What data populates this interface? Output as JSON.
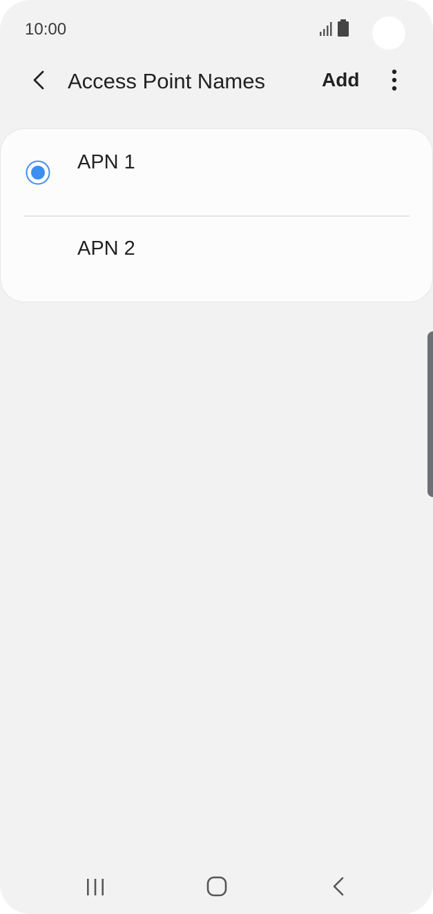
{
  "status_bar": {
    "time": "10:00",
    "signal_icon": "signal-bars-icon",
    "battery_icon": "battery-icon"
  },
  "app_bar": {
    "title": "Access Point Names",
    "add_label": "Add",
    "back_icon": "chevron-left-icon",
    "more_icon": "more-vertical-icon"
  },
  "apn_list": {
    "items": [
      {
        "label": "APN 1",
        "selected": true
      },
      {
        "label": "APN 2",
        "selected": false
      }
    ]
  },
  "nav_bar": {
    "recents_icon": "recents-icon",
    "home_icon": "home-icon",
    "back_icon": "back-icon"
  },
  "colors": {
    "accent": "#3e8ef0",
    "background": "#f2f2f2",
    "card": "#fcfcfc",
    "text": "#222222"
  }
}
